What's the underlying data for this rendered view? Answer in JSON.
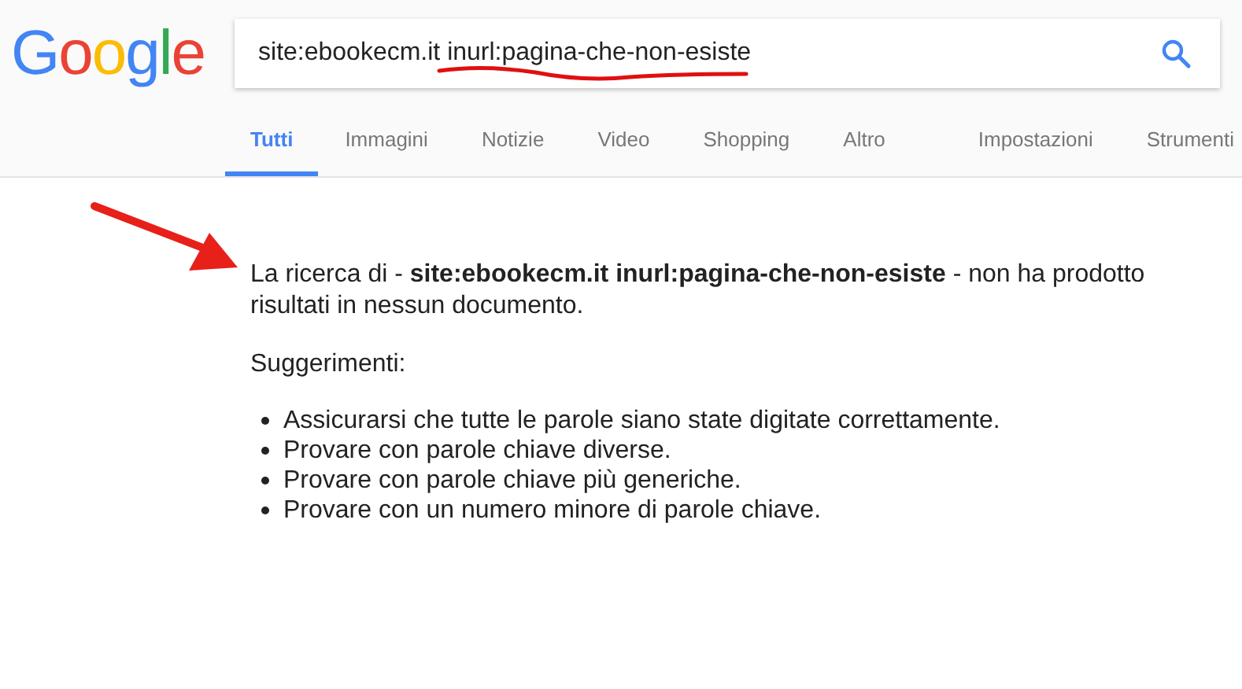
{
  "logo": "Google",
  "search": {
    "value": "site:ebookecm.it inurl:pagina-che-non-esiste"
  },
  "tabs": [
    {
      "label": "Tutti",
      "selected": true
    },
    {
      "label": "Immagini",
      "selected": false
    },
    {
      "label": "Notizie",
      "selected": false
    },
    {
      "label": "Video",
      "selected": false
    },
    {
      "label": "Shopping",
      "selected": false
    },
    {
      "label": "Altro",
      "selected": false
    }
  ],
  "tools": [
    "Impostazioni",
    "Strumenti"
  ],
  "message": "La ricerca di - **site:ebookecm.it inurl:pagina-che-non-esiste** - non ha prodotto risultati in nessun documento.",
  "suggestions_heading": "Suggerimenti:",
  "suggestions": [
    "Assicurarsi che tutte le parole siano state digitate correttamente.",
    "Provare con parole chiave diverse.",
    "Provare con parole chiave più generiche.",
    "Provare con un numero minore di parole chiave."
  ]
}
